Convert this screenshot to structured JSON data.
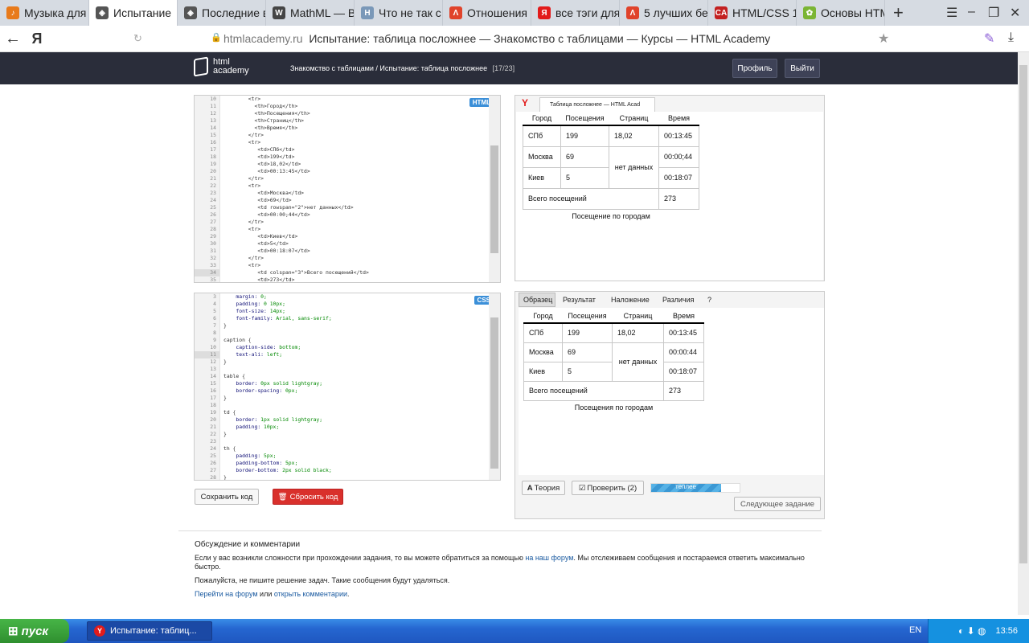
{
  "browser": {
    "tabs": [
      {
        "label": "Музыка для",
        "color": "#e87a1a",
        "glyph": "♪"
      },
      {
        "label": "Испытание",
        "color": "#555",
        "glyph": "◈",
        "active": true
      },
      {
        "label": "Последние в",
        "color": "#555",
        "glyph": "◈"
      },
      {
        "label": "MathML — В",
        "color": "#444",
        "glyph": "W"
      },
      {
        "label": "Что не так с",
        "color": "#7a98b8",
        "glyph": "H"
      },
      {
        "label": "Отношения",
        "color": "#e0432b",
        "glyph": "Λ"
      },
      {
        "label": "все тэги для",
        "color": "#e21b1b",
        "glyph": "Я"
      },
      {
        "label": "5 лучших бе",
        "color": "#e0432b",
        "glyph": "Λ"
      },
      {
        "label": "HTML/CSS 1",
        "color": "#c32020",
        "glyph": "CA"
      },
      {
        "label": "Основы HTM",
        "color": "#7bb534",
        "glyph": "✿"
      }
    ],
    "url_host": "htmlacademy.ru",
    "url_title": "Испытание: таблица посложнее — Знакомство с таблицами — Курсы — HTML Academy",
    "yandex": "Я"
  },
  "header": {
    "logo_line1": "html",
    "logo_line2": "academy",
    "breadcrumb": "Знакомство с таблицами / Испытание: таблица посложнее",
    "counter": "[17/23]",
    "profile_label": "Профиль",
    "logout_label": "Выйти"
  },
  "html_editor": {
    "badge": "HTML",
    "lines": [
      {
        "n": "10",
        "t": "        <tr>"
      },
      {
        "n": "11",
        "t": "          <th>Город</th>"
      },
      {
        "n": "12",
        "t": "          <th>Посещения</th>"
      },
      {
        "n": "13",
        "t": "          <th>Страниц</th>"
      },
      {
        "n": "14",
        "t": "          <th>Время</th>"
      },
      {
        "n": "15",
        "t": "        </tr>"
      },
      {
        "n": "16",
        "t": "        <tr>"
      },
      {
        "n": "17",
        "t": "           <td>СПб</td>"
      },
      {
        "n": "18",
        "t": "           <td>199</td>"
      },
      {
        "n": "19",
        "t": "           <td>18,02</td>"
      },
      {
        "n": "20",
        "t": "           <td>00:13:45</td>"
      },
      {
        "n": "21",
        "t": "        </tr>"
      },
      {
        "n": "22",
        "t": "        <tr>"
      },
      {
        "n": "23",
        "t": "           <td>Москва</td>"
      },
      {
        "n": "24",
        "t": "           <td>69</td>"
      },
      {
        "n": "25",
        "t": "           <td rowspan=\"2\">нет данных</td>"
      },
      {
        "n": "26",
        "t": "           <td>00:00;44</td>"
      },
      {
        "n": "27",
        "t": "        </tr>"
      },
      {
        "n": "28",
        "t": "        <tr>"
      },
      {
        "n": "29",
        "t": "           <td>Киев</td>"
      },
      {
        "n": "30",
        "t": "           <td>5</td>"
      },
      {
        "n": "31",
        "t": "           <td>00:18:07</td>"
      },
      {
        "n": "32",
        "t": "        </tr>"
      },
      {
        "n": "33",
        "t": "        <tr>"
      },
      {
        "n": "34",
        "t": "           <td colspan=\"3\">Всего посещений</td>"
      },
      {
        "n": "35",
        "t": "           <td>273</td>"
      }
    ]
  },
  "css_editor": {
    "badge": "CSS",
    "lines": [
      {
        "n": "3",
        "t": "    margin: 0;"
      },
      {
        "n": "4",
        "t": "    padding: 0 10px;"
      },
      {
        "n": "5",
        "t": "    font-size: 14px;"
      },
      {
        "n": "6",
        "t": "    font-family: Arial, sans-serif;"
      },
      {
        "n": "7",
        "t": "}"
      },
      {
        "n": "8",
        "t": ""
      },
      {
        "n": "9",
        "t": "caption {"
      },
      {
        "n": "10",
        "t": "    caption-side: bottom;"
      },
      {
        "n": "11",
        "t": "    text-ali: left;"
      },
      {
        "n": "12",
        "t": "}"
      },
      {
        "n": "13",
        "t": ""
      },
      {
        "n": "14",
        "t": "table {"
      },
      {
        "n": "15",
        "t": "    border: 0px solid lightgray;"
      },
      {
        "n": "16",
        "t": "    border-spacing: 0px;"
      },
      {
        "n": "17",
        "t": "}"
      },
      {
        "n": "18",
        "t": ""
      },
      {
        "n": "19",
        "t": "td {"
      },
      {
        "n": "20",
        "t": "    border: 1px solid lightgray;"
      },
      {
        "n": "21",
        "t": "    padding: 10px;"
      },
      {
        "n": "22",
        "t": "}"
      },
      {
        "n": "23",
        "t": ""
      },
      {
        "n": "24",
        "t": "th {"
      },
      {
        "n": "25",
        "t": "    padding: 5px;"
      },
      {
        "n": "26",
        "t": "    padding-bottom: 5px;"
      },
      {
        "n": "27",
        "t": "    border-bottom: 2px solid black;"
      },
      {
        "n": "28",
        "t": "}"
      }
    ]
  },
  "buttons": {
    "save": "Сохранить код",
    "reset": "Сбросить код"
  },
  "preview_top": {
    "tab_title": "Таблица посложнее — HTML Acad",
    "table": {
      "headers": [
        "Город",
        "Посещения",
        "Страниц",
        "Время"
      ],
      "r1": [
        "СПб",
        "199",
        "18,02",
        "00:13:45"
      ],
      "r2": [
        "Москва",
        "69",
        "нет данных",
        "00:00;44"
      ],
      "r3": [
        "Киев",
        "5",
        "00:18:07"
      ],
      "total_label": "Всего посещений",
      "total_value": "273",
      "caption": "Посещение по городам"
    }
  },
  "preview_bottom": {
    "tabs": [
      "Образец",
      "Результат",
      "Наложение",
      "Различия",
      "?"
    ],
    "table": {
      "headers": [
        "Город",
        "Посещения",
        "Страниц",
        "Время"
      ],
      "r1": [
        "СПб",
        "199",
        "18,02",
        "00:13:45"
      ],
      "r2": [
        "Москва",
        "69",
        "нет данных",
        "00:00:44"
      ],
      "r3": [
        "Киев",
        "5",
        "00:18:07"
      ],
      "total_label": "Всего посещений",
      "total_value": "273",
      "caption": "Посещения по городам"
    },
    "theory": "Теория",
    "check": "Проверить (2)",
    "progress_label": "теплее",
    "progress": 0.78,
    "next": "Следующее задание"
  },
  "comments": {
    "title": "Обсуждение и комментарии",
    "p1_before": "Если у вас возникли сложности при прохождении задания, то вы можете обратиться за помощью ",
    "p1_link": "на наш форум",
    "p1_after": ". Мы отслеживаем сообщения и постараемся ответить максимально быстро.",
    "p2": "Пожалуйста, не пишите решение задач. Такие сообщения будут удаляться.",
    "link_forum": "Перейти на форум",
    "or": " или ",
    "link_comments": "открыть комментарии",
    "dot": "."
  },
  "taskbar": {
    "start": "пуск",
    "task": "Испытание: таблиц...",
    "lang": "EN",
    "clock": "13:56"
  }
}
